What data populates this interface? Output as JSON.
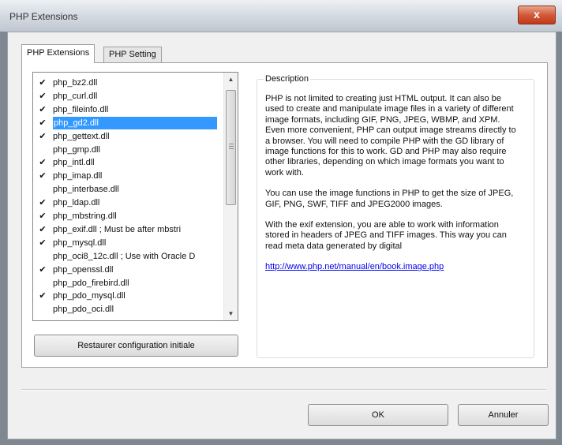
{
  "window": {
    "title": "PHP Extensions",
    "close_glyph": "x"
  },
  "tabs": [
    {
      "label": "PHP Extensions",
      "active": true
    },
    {
      "label": "PHP Setting",
      "active": false
    }
  ],
  "extensions": [
    {
      "label": "php_bz2.dll",
      "checked": true
    },
    {
      "label": "php_curl.dll",
      "checked": true
    },
    {
      "label": "php_fileinfo.dll",
      "checked": true
    },
    {
      "label": "php_gd2.dll",
      "checked": true,
      "selected": true
    },
    {
      "label": "php_gettext.dll",
      "checked": true
    },
    {
      "label": "php_gmp.dll",
      "checked": false
    },
    {
      "label": "php_intl.dll",
      "checked": true
    },
    {
      "label": "php_imap.dll",
      "checked": true
    },
    {
      "label": "php_interbase.dll",
      "checked": false
    },
    {
      "label": "php_ldap.dll",
      "checked": true
    },
    {
      "label": "php_mbstring.dll",
      "checked": true
    },
    {
      "label": "php_exif.dll      ; Must be after mbstri",
      "checked": true
    },
    {
      "label": "php_mysql.dll",
      "checked": true
    },
    {
      "label": "php_oci8_12c.dll  ; Use with Oracle D",
      "checked": false
    },
    {
      "label": "php_openssl.dll",
      "checked": true
    },
    {
      "label": "php_pdo_firebird.dll",
      "checked": false
    },
    {
      "label": "php_pdo_mysql.dll",
      "checked": true
    },
    {
      "label": "php_pdo_oci.dll",
      "checked": false
    }
  ],
  "check_glyph": "✔",
  "restore_label": "Restaurer configuration initiale",
  "description": {
    "legend": "Description",
    "paragraphs": [
      "PHP is not limited to creating just HTML output. It can also be used to create and manipulate image files in a variety of different image formats, including GIF, PNG, JPEG, WBMP, and XPM. Even more convenient, PHP can output image streams directly to a browser. You will need to compile PHP with the GD library of image functions for this to work. GD and PHP may also require other libraries, depending on which image formats you want to work with.",
      "You can use the image functions in PHP to get the size of JPEG, GIF, PNG, SWF, TIFF and JPEG2000 images.",
      "With the exif extension, you are able to work with information stored in headers of JPEG and TIFF images. This way you can read meta data generated by digital"
    ],
    "link": "http://www.php.net/manual/en/book.image.php"
  },
  "buttons": {
    "ok": "OK",
    "cancel": "Annuler"
  },
  "icons": {
    "scroll_up": "scroll-up-arrow-icon",
    "scroll_down": "scroll-down-arrow-icon"
  }
}
